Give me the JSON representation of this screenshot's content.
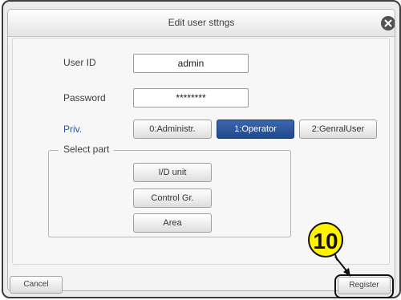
{
  "dialog": {
    "title": "Edit user sttngs",
    "close_icon": "close-icon"
  },
  "form": {
    "user_id_label": "User ID",
    "user_id_value": "admin",
    "password_label": "Password",
    "password_value": "********",
    "priv_label": "Priv.",
    "priv_options": [
      "0:Administr.",
      "1:Operator",
      "2:GenralUser"
    ],
    "priv_selected": "1:Operator"
  },
  "select_part": {
    "title": "Select part",
    "buttons": [
      "I/D unit",
      "Control Gr.",
      "Area"
    ]
  },
  "footer": {
    "cancel_label": "Cancel",
    "register_label": "Register"
  },
  "annotation": {
    "step_number": "10"
  },
  "colors": {
    "selected_button": "#2b559b",
    "priv_label": "#2f56a0",
    "step_marker_fill": "#fff200"
  }
}
